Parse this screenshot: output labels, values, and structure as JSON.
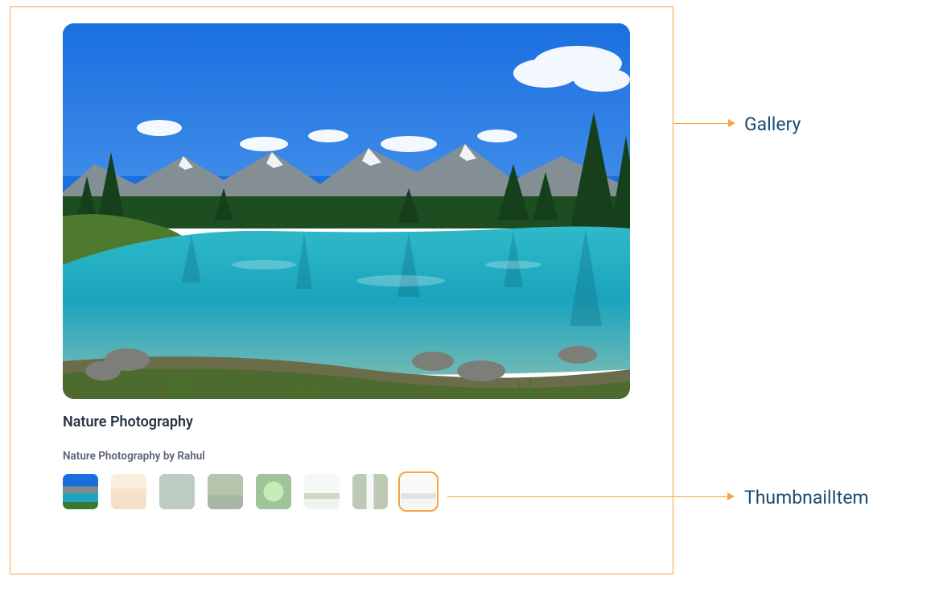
{
  "annotations": {
    "gallery_label": "Gallery",
    "thumbnail_label": "ThumbnailItem"
  },
  "gallery": {
    "title": "Nature Photography",
    "subtitle": "Nature Photography by Rahul",
    "main_image_alt": "Mountain lake landscape",
    "thumbnails": [
      {
        "name": "mountain-lake",
        "selected": true,
        "faded": false
      },
      {
        "name": "sunset-reflection",
        "selected": false,
        "faded": true
      },
      {
        "name": "coastal-arch",
        "selected": false,
        "faded": true
      },
      {
        "name": "forest-hills",
        "selected": false,
        "faded": true
      },
      {
        "name": "fern-spiral",
        "selected": false,
        "faded": true
      },
      {
        "name": "lone-tree",
        "selected": false,
        "faded": true
      },
      {
        "name": "waterfall",
        "selected": false,
        "faded": true
      },
      {
        "name": "foggy-tree",
        "selected": false,
        "faded": true
      }
    ],
    "hovered_thumbnail_index": 7
  }
}
